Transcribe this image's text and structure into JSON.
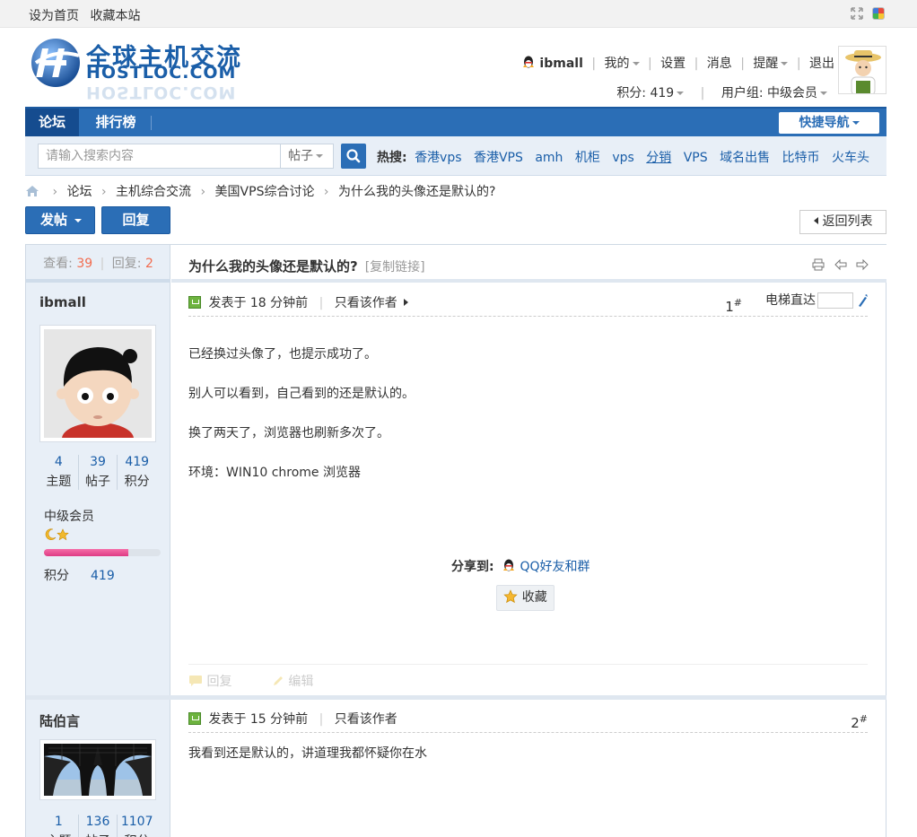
{
  "topbar": {
    "set_home": "设为首页",
    "bookmark": "收藏本站"
  },
  "logo": {
    "cn": "全球主机交流",
    "en": "HOSTLOC.COM"
  },
  "user": {
    "name": "ibmall",
    "my": "我的",
    "settings": "设置",
    "messages": "消息",
    "reminders": "提醒",
    "logout": "退出",
    "points_label": "积分: 419",
    "group_label": "用户组: 中级会员"
  },
  "nav": {
    "forum": "论坛",
    "rank": "排行榜",
    "quick_nav": "快捷导航"
  },
  "search": {
    "placeholder": "请输入搜索内容",
    "type": "帖子",
    "hot_label": "热搜:",
    "hot": [
      "香港vps",
      "香港VPS",
      "amh",
      "机柜",
      "vps",
      "分销",
      "VPS",
      "域名出售",
      "比特币",
      "火车头"
    ]
  },
  "breadcrumb": [
    "论坛",
    "主机综合交流",
    "美国VPS综合讨论",
    "为什么我的头像还是默认的?"
  ],
  "buttons": {
    "post": "发帖",
    "reply": "回复",
    "back": "返回列表"
  },
  "thread": {
    "views_label": "查看:",
    "views": "39",
    "replies_label": "回复:",
    "replies": "2",
    "title": "为什么我的头像还是默认的?",
    "copy_link": "[复制链接]"
  },
  "posts": [
    {
      "author": "ibmall",
      "stats": [
        {
          "n": "4",
          "l": "主题"
        },
        {
          "n": "39",
          "l": "帖子"
        },
        {
          "n": "419",
          "l": "积分"
        }
      ],
      "level": "中级会员",
      "level_progress": 0.72,
      "score_label": "积分",
      "score": "419",
      "posted": "发表于 18 分钟前",
      "only_author": "只看该作者",
      "floor": "1",
      "jump_label": "电梯直达",
      "content": [
        "已经换过头像了，也提示成功了。",
        "别人可以看到，自己看到的还是默认的。",
        "换了两天了，浏览器也刷新多次了。",
        "环境：WIN10  chrome 浏览器"
      ],
      "share_label": "分享到:",
      "share_target": "QQ好友和群",
      "favorite": "收藏",
      "reply": "回复",
      "edit": "编辑"
    },
    {
      "author": "陆伯言",
      "stats": [
        {
          "n": "1",
          "l": "主题"
        },
        {
          "n": "136",
          "l": "帖子"
        },
        {
          "n": "1107",
          "l": "积分"
        }
      ],
      "posted": "发表于 15 分钟前",
      "only_author": "只看该作者",
      "floor": "2",
      "content": [
        "我看到还是默认的，讲道理我都怀疑你在水"
      ]
    }
  ],
  "colors": {
    "brand_blue": "#2b6eb6",
    "link_blue": "#1a5ea8",
    "accent_red": "#f26c4f",
    "level_pink": "#dd3b84"
  }
}
